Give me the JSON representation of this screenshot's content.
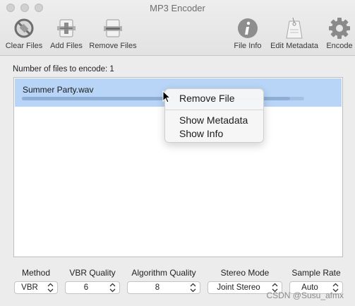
{
  "window": {
    "title": "MP3 Encoder"
  },
  "toolbar": {
    "clear_files": "Clear Files",
    "add_files": "Add Files",
    "remove_files": "Remove Files",
    "file_info": "File Info",
    "edit_metadata": "Edit Metadata",
    "encode": "Encode"
  },
  "main": {
    "count_label": "Number of files to encode: 1",
    "files": [
      {
        "name": "Summer Party.wav",
        "progress": 0.95
      }
    ]
  },
  "context_menu": {
    "items": [
      "Remove File",
      "Show Metadata",
      "Show Info"
    ]
  },
  "options": {
    "method": {
      "label": "Method",
      "value": "VBR"
    },
    "vbr_quality": {
      "label": "VBR Quality",
      "value": "6"
    },
    "algorithm_quality": {
      "label": "Algorithm Quality",
      "value": "8"
    },
    "stereo_mode": {
      "label": "Stereo Mode",
      "value": "Joint Stereo"
    },
    "sample_rate": {
      "label": "Sample Rate",
      "value": "Auto"
    }
  },
  "watermark": "CSDN @Susu_afmx",
  "colors": {
    "selection": "#b8d4f6",
    "window_bg": "#ececec"
  }
}
